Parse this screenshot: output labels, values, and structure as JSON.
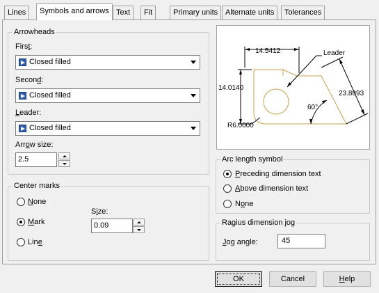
{
  "tabs": [
    {
      "label": "Lines"
    },
    {
      "label": "Symbols and arrows",
      "active": true
    },
    {
      "label": "Text"
    },
    {
      "label": "Fit"
    },
    {
      "label": "Primary units"
    },
    {
      "label": "Alternate units"
    },
    {
      "label": "Tolerances"
    }
  ],
  "arrowheads": {
    "title": "Arrowheads",
    "first": {
      "label_pre": "Firs",
      "label_key": "t",
      "label_post": ":",
      "value": "Closed filled"
    },
    "second": {
      "label_pre": "Secon",
      "label_key": "d",
      "label_post": ":",
      "value": "Closed filled"
    },
    "leader": {
      "label_key": "L",
      "label_post": "eader:",
      "value": "Closed filled"
    },
    "arrow_size": {
      "label_pre": "Arr",
      "label_key": "o",
      "label_post": "w size:",
      "value": "2.5"
    }
  },
  "center_marks": {
    "title": "Center marks",
    "options": [
      {
        "label_pre": "",
        "label_key": "N",
        "label_post": "one",
        "selected": false
      },
      {
        "label_pre": "",
        "label_key": "M",
        "label_post": "ark",
        "selected": true
      },
      {
        "label_pre": "Lin",
        "label_key": "e",
        "label_post": "",
        "selected": false
      }
    ],
    "size": {
      "label_pre": "S",
      "label_key": "i",
      "label_post": "ze:",
      "value": "0.09"
    }
  },
  "preview": {
    "dim_top": "14.5412",
    "dim_left": "14.0140",
    "dim_right": "23.8893",
    "angle": "60°",
    "radius": "R6.0000",
    "leader": "Leader"
  },
  "arc_length": {
    "title": "Arc length symbol",
    "options": [
      {
        "label_pre": "",
        "label_key": "P",
        "label_post": "receding dimension text",
        "selected": true
      },
      {
        "label_pre": "",
        "label_key": "A",
        "label_post": "bove dimension text",
        "selected": false
      },
      {
        "label_pre": "N",
        "label_key": "o",
        "label_post": "ne",
        "selected": false
      }
    ]
  },
  "radius_jog": {
    "title": "Ragius dimension jog",
    "jog_angle": {
      "label_key": "J",
      "label_post": "og angle:",
      "value": "45"
    }
  },
  "buttons": {
    "ok": "OK",
    "cancel": "Cancel",
    "help_key": "H",
    "help_post": "elp"
  },
  "colors": {
    "preview_geometry": "#c8a050",
    "combo_swatch": "#2f5fae"
  }
}
